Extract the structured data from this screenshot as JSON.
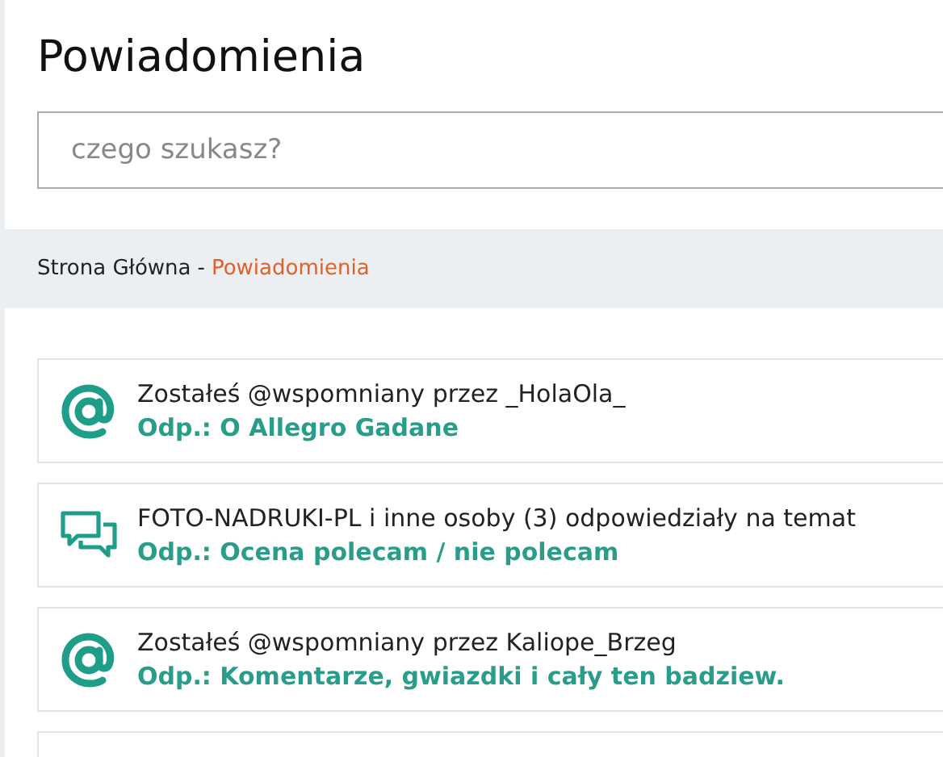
{
  "title": "Powiadomienia",
  "search": {
    "placeholder": "czego szukasz?"
  },
  "breadcrumb": [
    {
      "label": "Strona Główna",
      "current": false
    },
    {
      "label": "Powiadomienia",
      "current": true
    }
  ],
  "breadcrumb_separator": "-",
  "notifications": [
    {
      "kind": "mention",
      "text": "Zostałeś @wspomniany przez _HolaOla_",
      "link": "Odp.: O Allegro Gadane"
    },
    {
      "kind": "replies",
      "text": "FOTO-NADRUKI-PL i inne osoby (3) odpowiedziały na temat",
      "link": "Odp.: Ocena polecam / nie polecam"
    },
    {
      "kind": "mention",
      "text": "Zostałeś @wspomniany przez Kaliope_Brzeg",
      "link": "Odp.: Komentarze, gwiazdki i cały ten badziew."
    }
  ]
}
